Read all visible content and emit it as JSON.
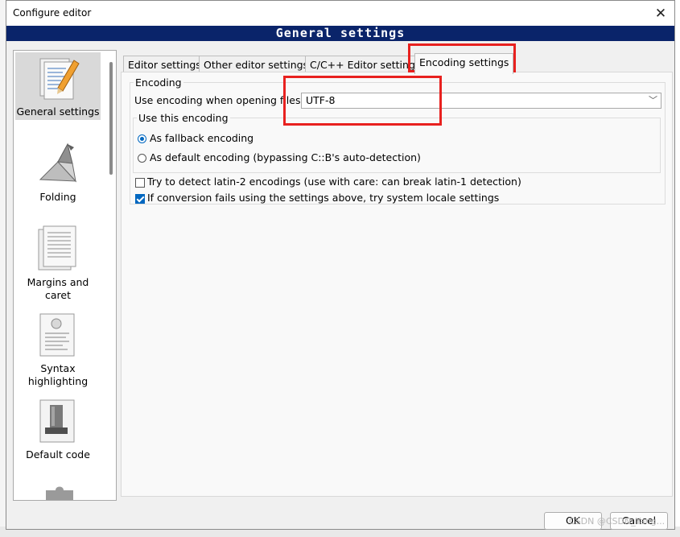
{
  "dialog": {
    "title": "Configure editor",
    "close_glyph": "✕"
  },
  "banner": {
    "title": "General settings"
  },
  "sidebar": {
    "items": [
      {
        "label": "General settings",
        "icon": "general-settings-icon"
      },
      {
        "label": "Folding",
        "icon": "folding-icon"
      },
      {
        "label": "Margins and caret",
        "icon": "margins-icon"
      },
      {
        "label": "Syntax highlighting",
        "icon": "syntax-icon"
      },
      {
        "label": "Default code",
        "icon": "default-code-icon"
      }
    ]
  },
  "tabs": [
    {
      "label": "Editor settings"
    },
    {
      "label": "Other editor settings"
    },
    {
      "label": "C/C++ Editor settings"
    },
    {
      "label": "Encoding settings",
      "active": true
    }
  ],
  "encoding": {
    "group_label": "Encoding",
    "use_label": "Use encoding when opening files:",
    "value": "UTF-8",
    "sub_group_label": "Use this encoding",
    "radio_fallback": "As fallback encoding",
    "radio_default": "As default encoding (bypassing C::B's auto-detection)",
    "check_latin2": "Try to detect latin-2 encodings (use with care: can break latin-1 detection)",
    "check_locale": "If conversion fails using the settings above, try system locale settings"
  },
  "buttons": {
    "ok": "OK",
    "cancel": "Cancel"
  },
  "watermark": "CSDN @CSDN_Yang...",
  "accent_color": "#0a246a",
  "annotation_color": "#e8211f"
}
